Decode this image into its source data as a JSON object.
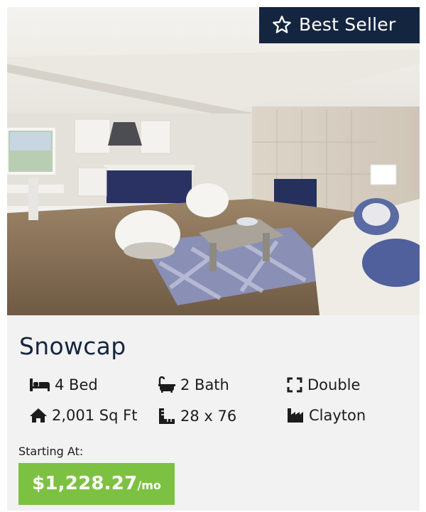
{
  "badge": {
    "icon": "star-outline-icon",
    "label": "Best Seller"
  },
  "home": {
    "name": "Snowcap",
    "photo_alt": "Snowcap living room interior",
    "specs": [
      {
        "icon": "bed-icon",
        "text": "4 Bed"
      },
      {
        "icon": "bath-icon",
        "text": "2 Bath"
      },
      {
        "icon": "section-icon",
        "text": "Double"
      },
      {
        "icon": "house-icon",
        "text": "2,001 Sq Ft"
      },
      {
        "icon": "ruler-icon",
        "text": "28 x 76"
      },
      {
        "icon": "factory-icon",
        "text": "Clayton"
      }
    ],
    "starting_label": "Starting At:",
    "price": "$1,228.27",
    "price_unit": "/mo"
  },
  "colors": {
    "navy": "#142540",
    "green": "#7dc142",
    "card_bg": "#f2f2f2",
    "text": "#1c1c1c"
  }
}
